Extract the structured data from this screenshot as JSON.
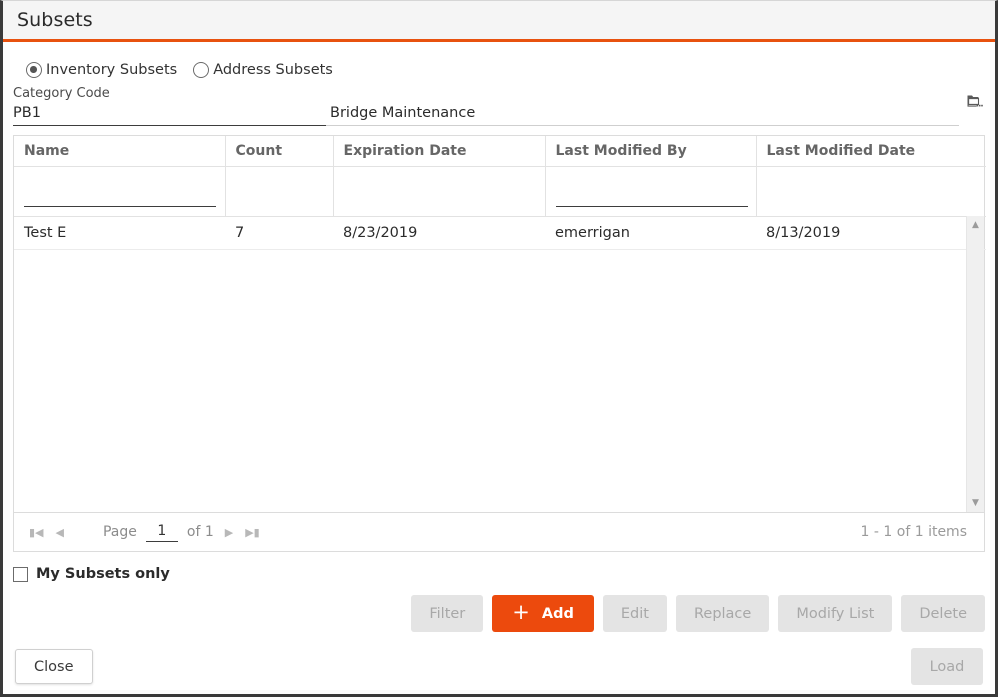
{
  "window": {
    "title": "Subsets",
    "accent_color": "#e8520f",
    "titlebar_bg": "#f5f5f5"
  },
  "subset_type": {
    "options": [
      {
        "label": "Inventory Subsets",
        "selected": true
      },
      {
        "label": "Address Subsets",
        "selected": false
      }
    ]
  },
  "category": {
    "label": "Category Code",
    "code_value": "PB1",
    "description_value": "Bridge Maintenance",
    "browse_icon": "folder-browse-icon"
  },
  "grid": {
    "columns": [
      "Name",
      "Count",
      "Expiration Date",
      "Last Modified By",
      "Last Modified Date"
    ],
    "filters": [
      "",
      "",
      "",
      "",
      ""
    ],
    "rows": [
      {
        "name": "Test E",
        "count": "7",
        "expiration_date": "8/23/2019",
        "last_modified_by": "emerrigan",
        "last_modified_date": "8/13/2019"
      }
    ],
    "scrollbar": {
      "up_arrow": "triangle-up-icon",
      "down_arrow": "triangle-down-icon"
    }
  },
  "pager": {
    "first_icon": "first-page-icon",
    "prev_icon": "prev-page-icon",
    "page_label": "Page",
    "page_value": "1",
    "of_label": "of 1",
    "next_icon": "next-page-icon",
    "last_icon": "last-page-icon",
    "items_summary": "1 - 1 of 1 items"
  },
  "my_subsets": {
    "label": "My Subsets only",
    "checked": false
  },
  "actions": {
    "filter_label": "Filter",
    "add_label": "Add",
    "add_icon": "plus-icon",
    "edit_label": "Edit",
    "replace_label": "Replace",
    "modify_list_label": "Modify List",
    "delete_label": "Delete",
    "primary_color": "#ec4a0d"
  },
  "footer": {
    "close_label": "Close",
    "load_label": "Load"
  }
}
